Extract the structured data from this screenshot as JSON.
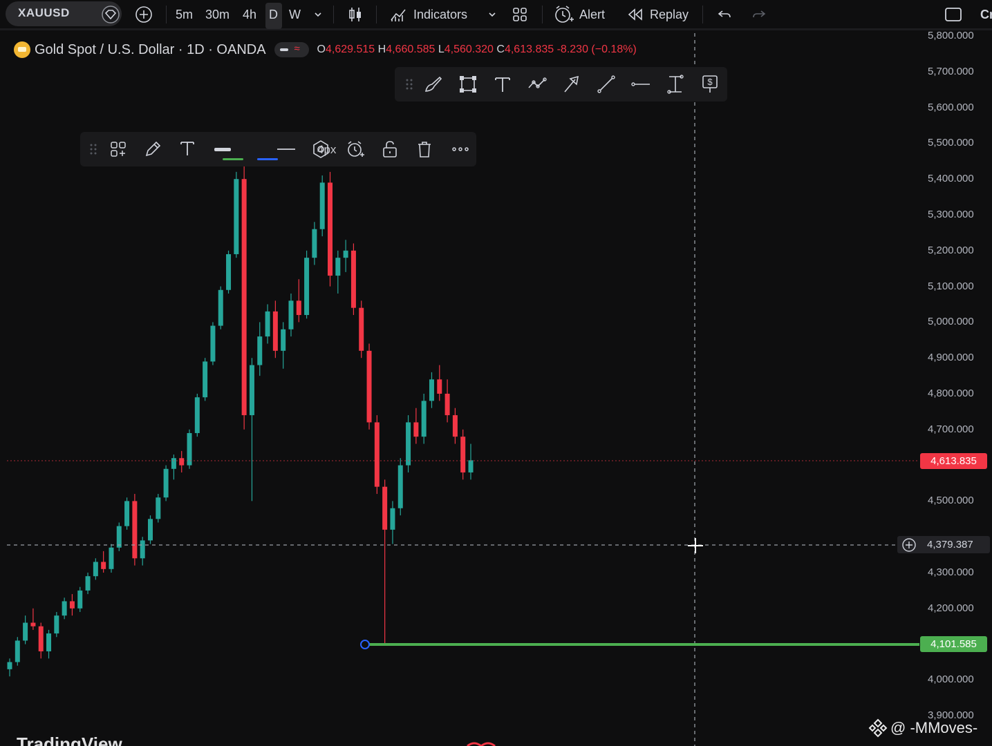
{
  "toolbar": {
    "symbol": "XAUUSD",
    "intervals": [
      "5m",
      "30m",
      "4h",
      "D",
      "W"
    ],
    "active_interval": "D",
    "indicators_label": "Indicators",
    "alert_label": "Alert",
    "replay_label": "Replay",
    "right_cut_text": "Cr"
  },
  "legend": {
    "title": "Gold Spot / U.S. Dollar · 1D · OANDA",
    "open_key": "O",
    "open": "4,629.515",
    "high_key": "H",
    "high": "4,660.585",
    "low_key": "L",
    "low": "4,560.320",
    "close_key": "C",
    "close": "4,613.835",
    "change": "-8.230 (−0.18%)"
  },
  "line_toolbar": {
    "width_label": "4px"
  },
  "price_axis": {
    "labels": [
      "5,800.000",
      "5,700.000",
      "5,600.000",
      "5,500.000",
      "5,400.000",
      "5,300.000",
      "5,200.000",
      "5,100.000",
      "5,000.000",
      "4,900.000",
      "4,800.000",
      "4,700.000",
      "4,500.000",
      "4,300.000",
      "4,200.000",
      "4,000.000",
      "3,900.000"
    ],
    "last_price": "4,613.835",
    "crosshair_price": "4,379.387",
    "hline_price": "4,101.585"
  },
  "colors": {
    "up": "#26a69a",
    "down": "#f23645",
    "hline": "#4caf50",
    "background": "#0e0e0f"
  },
  "watermark": "@ -MMoves-",
  "brand": "TradingView",
  "chart_data": {
    "type": "candlestick",
    "title": "Gold Spot / U.S. Dollar · 1D · OANDA",
    "y_axis_range": [
      3900,
      5800
    ],
    "last_close": 4613.835,
    "horizontal_line": 4101.585,
    "crosshair_price": 4379.387,
    "ohlc": [
      [
        4030,
        4060,
        4010,
        4050
      ],
      [
        4050,
        4120,
        4040,
        4110
      ],
      [
        4110,
        4180,
        4100,
        4160
      ],
      [
        4160,
        4200,
        4140,
        4150
      ],
      [
        4150,
        4160,
        4060,
        4080
      ],
      [
        4080,
        4140,
        4060,
        4130
      ],
      [
        4130,
        4190,
        4120,
        4180
      ],
      [
        4180,
        4230,
        4170,
        4220
      ],
      [
        4220,
        4240,
        4180,
        4200
      ],
      [
        4200,
        4260,
        4190,
        4250
      ],
      [
        4250,
        4300,
        4240,
        4290
      ],
      [
        4290,
        4340,
        4280,
        4330
      ],
      [
        4330,
        4360,
        4300,
        4310
      ],
      [
        4310,
        4380,
        4300,
        4370
      ],
      [
        4370,
        4440,
        4360,
        4430
      ],
      [
        4430,
        4510,
        4420,
        4500
      ],
      [
        4500,
        4520,
        4320,
        4340
      ],
      [
        4340,
        4400,
        4320,
        4390
      ],
      [
        4390,
        4460,
        4380,
        4450
      ],
      [
        4450,
        4520,
        4440,
        4510
      ],
      [
        4510,
        4600,
        4500,
        4590
      ],
      [
        4590,
        4630,
        4560,
        4620
      ],
      [
        4620,
        4640,
        4580,
        4600
      ],
      [
        4600,
        4700,
        4590,
        4690
      ],
      [
        4690,
        4800,
        4680,
        4790
      ],
      [
        4790,
        4900,
        4780,
        4890
      ],
      [
        4890,
        5000,
        4880,
        4990
      ],
      [
        4990,
        5100,
        4980,
        5090
      ],
      [
        5090,
        5200,
        5080,
        5190
      ],
      [
        5190,
        5420,
        5180,
        5400
      ],
      [
        5400,
        5450,
        4700,
        4740
      ],
      [
        4740,
        4900,
        4500,
        4880
      ],
      [
        4880,
        5000,
        4850,
        4960
      ],
      [
        4960,
        5050,
        4940,
        5030
      ],
      [
        5030,
        5060,
        4900,
        4920
      ],
      [
        4920,
        5000,
        4870,
        4980
      ],
      [
        4980,
        5080,
        4960,
        5060
      ],
      [
        5060,
        5120,
        5000,
        5020
      ],
      [
        5020,
        5200,
        5010,
        5180
      ],
      [
        5180,
        5280,
        5160,
        5260
      ],
      [
        5260,
        5410,
        5240,
        5390
      ],
      [
        5390,
        5420,
        5100,
        5130
      ],
      [
        5130,
        5200,
        5080,
        5180
      ],
      [
        5180,
        5230,
        5140,
        5200
      ],
      [
        5200,
        5220,
        5020,
        5040
      ],
      [
        5040,
        5060,
        4900,
        4920
      ],
      [
        4920,
        4940,
        4700,
        4720
      ],
      [
        4720,
        4740,
        4520,
        4540
      ],
      [
        4540,
        4560,
        4100,
        4420
      ],
      [
        4420,
        4500,
        4380,
        4480
      ],
      [
        4480,
        4620,
        4460,
        4600
      ],
      [
        4600,
        4740,
        4580,
        4720
      ],
      [
        4720,
        4760,
        4660,
        4680
      ],
      [
        4680,
        4800,
        4660,
        4780
      ],
      [
        4780,
        4860,
        4760,
        4840
      ],
      [
        4840,
        4880,
        4780,
        4800
      ],
      [
        4800,
        4840,
        4720,
        4740
      ],
      [
        4740,
        4760,
        4660,
        4680
      ],
      [
        4680,
        4700,
        4560,
        4580
      ],
      [
        4580,
        4660,
        4560,
        4614
      ]
    ]
  }
}
